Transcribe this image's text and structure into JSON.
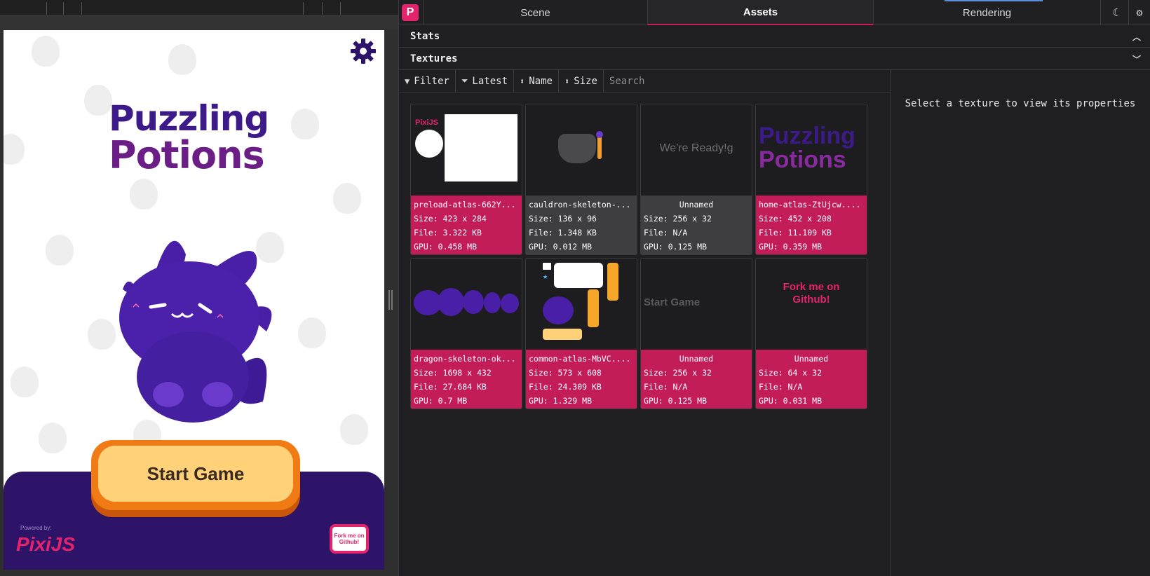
{
  "devtools": {
    "app_logo": "P",
    "tabs": [
      {
        "label": "Scene",
        "active": false
      },
      {
        "label": "Assets",
        "active": true
      },
      {
        "label": "Rendering",
        "active": false
      }
    ],
    "theme_icon": "moon-icon",
    "settings_icon": "gear-icon",
    "sections": {
      "stats": "Stats",
      "textures": "Textures"
    },
    "toolbar": {
      "filter": "Filter",
      "latest": "Latest",
      "name": "Name",
      "size": "Size",
      "search_placeholder": "Search"
    },
    "properties_message": "Select a texture to view its properties",
    "accent_color": "#c21d58",
    "textures": [
      {
        "name": "preload-atlas-662Y...",
        "size": "Size: 423 x 284",
        "file": "File: 3.322 KB",
        "gpu": "GPU: 0.458 MB",
        "style": "pink"
      },
      {
        "name": "cauldron-skeleton-...",
        "size": "Size: 136 x 96",
        "file": "File: 1.348 KB",
        "gpu": "GPU: 0.012 MB",
        "style": "gray"
      },
      {
        "name": "Unnamed",
        "size": "Size: 256 x 32",
        "file": "File: N/A",
        "gpu": "GPU: 0.125 MB",
        "style": "gray",
        "thumb_text": "We're Ready!g"
      },
      {
        "name": "home-atlas-ZtUjcw....",
        "size": "Size: 452 x 208",
        "file": "File: 11.109 KB",
        "gpu": "GPU: 0.359 MB",
        "style": "pink"
      },
      {
        "name": "dragon-skeleton-ok...",
        "size": "Size: 1698 x 432",
        "file": "File: 27.684 KB",
        "gpu": "GPU: 0.7 MB",
        "style": "pink"
      },
      {
        "name": "common-atlas-MbVC....",
        "size": "Size: 573 x 608",
        "file": "File: 24.309 KB",
        "gpu": "GPU: 1.329 MB",
        "style": "pink"
      },
      {
        "name": "Unnamed",
        "size": "Size: 256 x 32",
        "file": "File: N/A",
        "gpu": "GPU: 0.125 MB",
        "style": "pink",
        "thumb_text": "Start Game"
      },
      {
        "name": "Unnamed",
        "size": "Size: 64 x 32",
        "file": "File: N/A",
        "gpu": "GPU: 0.031 MB",
        "style": "pink",
        "thumb_text": "Fork me on Github!"
      }
    ]
  },
  "game": {
    "title_line1": "Puzzling",
    "title_line2": "Potions",
    "start_button": "Start Game",
    "powered_by": "Powered by:",
    "pixi_logo": "PixiJS",
    "fork_badge": "Fork me on Github!",
    "brand_color": "#3d1a8a",
    "button_color": "#f07a14"
  }
}
